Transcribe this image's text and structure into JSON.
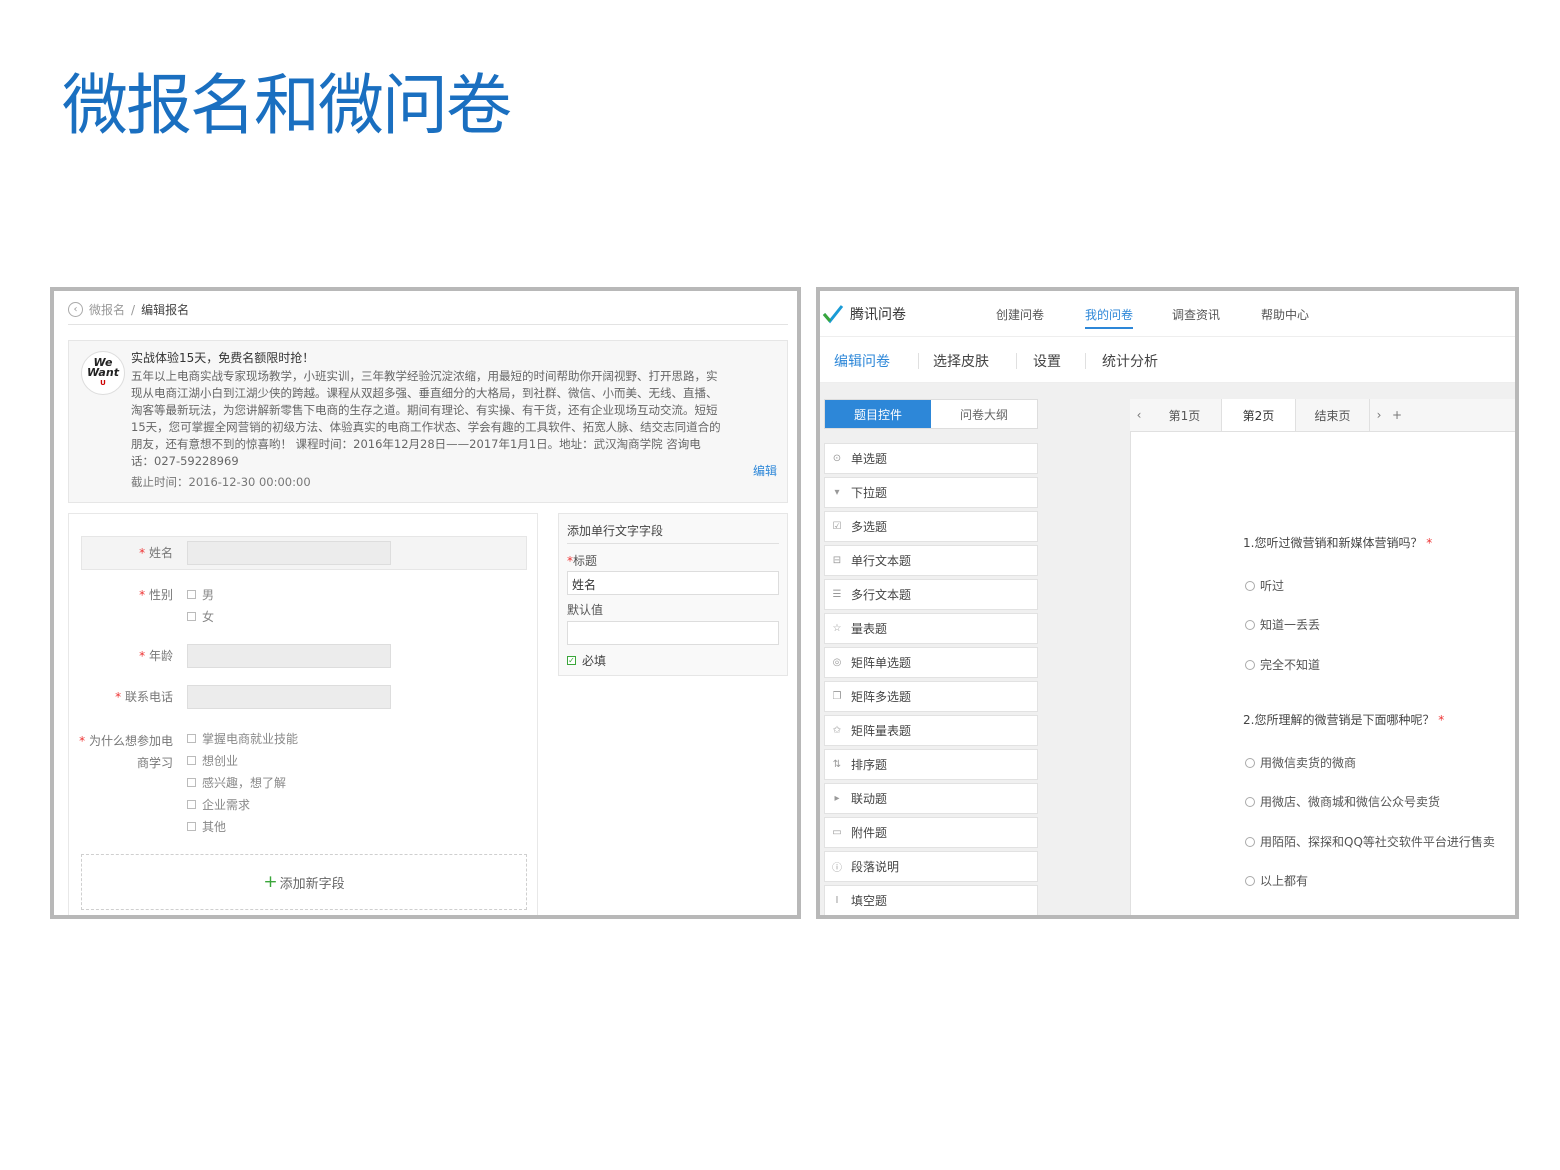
{
  "slide_title": "微报名和微问卷",
  "left_panel": {
    "breadcrumb": {
      "parent": "微报名",
      "separator": "/",
      "current": "编辑报名"
    },
    "event": {
      "logo_text_1": "We",
      "logo_text_2": "Want",
      "logo_text_3": "U",
      "title": "实战体验15天，免费名额限时抢！",
      "description": "五年以上电商实战专家现场教学，小班实训，三年教学经验沉淀浓缩，用最短的时间帮助你开阔视野、打开思路，实现从电商江湖小白到江湖少侠的跨越。课程从双超多强、垂直细分的大格局，到社群、微信、小而美、无线、直播、淘客等最新玩法，为您讲解新零售下电商的生存之道。期间有理论、有实操、有干货，还有企业现场互动交流。短短15天，您可掌握全网营销的初级方法、体验真实的电商工作状态、学会有趣的工具软件、拓宽人脉、结交志同道合的朋友，还有意想不到的惊喜哟！ 课程时间：2016年12月28日——2017年1月1日。地址：武汉淘商学院 咨询电话：027-59228969",
      "deadline": "截止时间：2016-12-30 00:00:00",
      "edit_label": "编辑"
    },
    "form": {
      "required_mark": "*",
      "name_label": "姓名",
      "gender_label": "性别",
      "gender_options": [
        "男",
        "女"
      ],
      "age_label": "年龄",
      "phone_label": "联系电话",
      "reason_label_1": "为什么想参加电",
      "reason_label_2": "商学习",
      "reason_options": [
        "掌握电商就业技能",
        "想创业",
        "感兴趣，想了解",
        "企业需求",
        "其他"
      ],
      "add_field": "添加新字段"
    },
    "side": {
      "title": "添加单行文字字段",
      "field_title_label": "标题",
      "field_title_value": "姓名",
      "default_label": "默认值",
      "default_value": "",
      "required_label": "必填"
    }
  },
  "right_panel": {
    "brand": "腾讯问卷",
    "nav": [
      "创建问卷",
      "我的问卷",
      "调查资讯",
      "帮助中心"
    ],
    "nav_active": 1,
    "subnav": [
      "编辑问卷",
      "选择皮肤",
      "设置",
      "统计分析"
    ],
    "ctrl_tabs": [
      "题目控件",
      "问卷大纲"
    ],
    "controls": [
      {
        "icon": "radio-icon",
        "glyph": "⊙",
        "label": "单选题"
      },
      {
        "icon": "dropdown-icon",
        "glyph": "▾",
        "label": "下拉题"
      },
      {
        "icon": "checkbox-icon",
        "glyph": "☑",
        "label": "多选题"
      },
      {
        "icon": "single-line-icon",
        "glyph": "⊟",
        "label": "单行文本题"
      },
      {
        "icon": "multi-line-icon",
        "glyph": "☰",
        "label": "多行文本题"
      },
      {
        "icon": "star-icon",
        "glyph": "☆",
        "label": "量表题"
      },
      {
        "icon": "matrix-radio-icon",
        "glyph": "◎",
        "label": "矩阵单选题"
      },
      {
        "icon": "matrix-checkbox-icon",
        "glyph": "❐",
        "label": "矩阵多选题"
      },
      {
        "icon": "matrix-scale-icon",
        "glyph": "✩",
        "label": "矩阵量表题"
      },
      {
        "icon": "sort-icon",
        "glyph": "⇅",
        "label": "排序题"
      },
      {
        "icon": "linkage-icon",
        "glyph": "▸",
        "label": "联动题"
      },
      {
        "icon": "attachment-icon",
        "glyph": "▭",
        "label": "附件题"
      },
      {
        "icon": "info-icon",
        "glyph": "ⓘ",
        "label": "段落说明"
      },
      {
        "icon": "fill-blank-icon",
        "glyph": "I",
        "label": "填空题"
      }
    ],
    "page_tabs": [
      "第1页",
      "第2页",
      "结束页"
    ],
    "page_tab_active": 1,
    "prev_arrow": "‹",
    "next_arrow": "›",
    "add_page": "+",
    "questions": [
      {
        "text": "1.您听过微营销和新媒体营销吗？",
        "required": "*",
        "options": [
          "听过",
          "知道一丢丢",
          "完全不知道"
        ]
      },
      {
        "text": "2.您所理解的微营销是下面哪种呢？",
        "required": "*",
        "options": [
          "用微信卖货的微商",
          "用微店、微商城和微信公众号卖货",
          "用陌陌、探探和QQ等社交软件平台进行售卖",
          "以上都有"
        ]
      }
    ],
    "colors": {
      "accent": "#2d87d8",
      "required": "#e33333"
    }
  }
}
